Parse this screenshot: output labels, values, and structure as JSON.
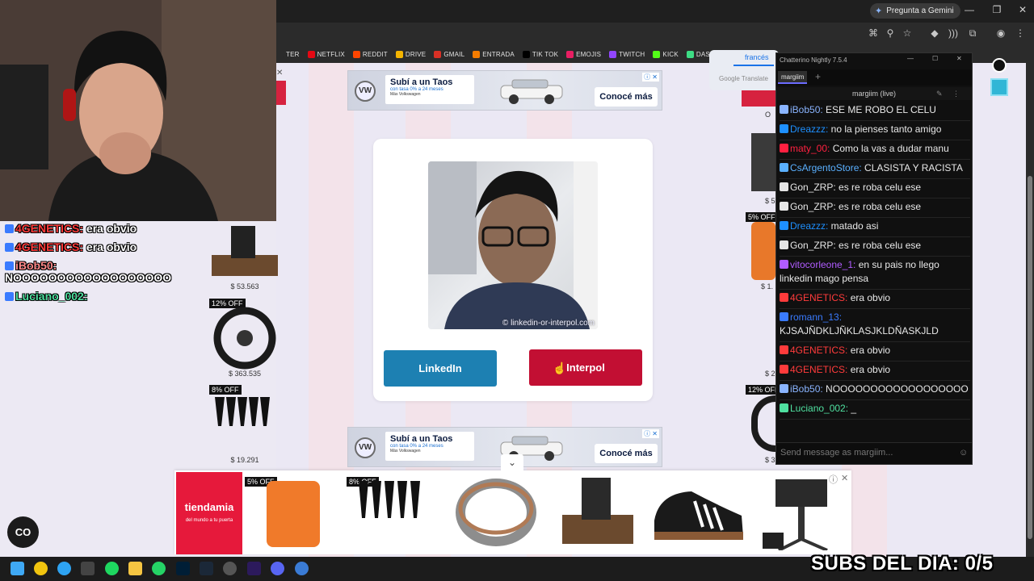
{
  "browser": {
    "gemini_label": "Pregunta a Gemini",
    "bookmarks": [
      {
        "label": "TER",
        "color": "#2b2b2b"
      },
      {
        "label": "NETFLIX",
        "color": "#e50914"
      },
      {
        "label": "REDDIT",
        "color": "#ff4500"
      },
      {
        "label": "DRIVE",
        "color": "#f4b400"
      },
      {
        "label": "GMAIL",
        "color": "#d93025"
      },
      {
        "label": "ENTRADA",
        "color": "#f57c00"
      },
      {
        "label": "TIK TOK",
        "color": "#000000"
      },
      {
        "label": "EMOJIS",
        "color": "#e91e63"
      },
      {
        "label": "TWITCH",
        "color": "#9146ff"
      },
      {
        "label": "KICK",
        "color": "#53fc18"
      },
      {
        "label": "DASHBO",
        "color": "#3ddc84"
      }
    ]
  },
  "translate": {
    "language": "francés",
    "brand": "Google Translate"
  },
  "ad": {
    "headline": "Subí a un Taos",
    "sub": "con tasa 0% a 24 meses",
    "brand_line": "Más Volkswagen",
    "cta": "Conocé más",
    "vw_mark": "VW"
  },
  "card": {
    "watermark": "© linkedin-or-interpol.com",
    "linkedin_label": "LinkedIn",
    "interpol_label": "Interpol"
  },
  "side_products": [
    {
      "price": "$ 53.563",
      "tag": ""
    },
    {
      "price": "$ 363.535",
      "tag": "12% OFF"
    },
    {
      "price": "$ 19.291",
      "tag": "8% OFF"
    }
  ],
  "right_products": [
    {
      "tag": "5% OFF",
      "price": "$ 1."
    },
    {
      "tag": "12% OFF",
      "price": "$ 3"
    },
    {
      "tag": "",
      "price": "$ 5"
    },
    {
      "tag": "",
      "price": "$ 2"
    }
  ],
  "bottom_ad": {
    "brand": "tiendamia",
    "tagline": "del mundo a tu puerta",
    "tags": [
      "5% OFF",
      "8% OFF"
    ]
  },
  "chatterino": {
    "title": "Chatterino Nightly 7.5.4",
    "tab": "margiim",
    "channel": "margiim (live)",
    "input_placeholder": "Send message as margiim...",
    "messages": [
      {
        "user": "iBob50:",
        "color": "#8ab4ff",
        "text": " ESE ME ROBO EL CELU"
      },
      {
        "user": "Dreazzz:",
        "color": "#1e90ff",
        "text": " no la pienses tanto amigo"
      },
      {
        "user": "maty_00:",
        "color": "#ff2040",
        "text": " Como la vas a dudar manu"
      },
      {
        "user": "CsArgentoStore:",
        "color": "#5ab0ff",
        "text": " CLASISTA Y RACISTA"
      },
      {
        "user": "Gon_ZRP:",
        "color": "#e6e6e6",
        "text": " es re roba celu ese"
      },
      {
        "user": "Gon_ZRP:",
        "color": "#e6e6e6",
        "text": " es re roba celu ese"
      },
      {
        "user": "Dreazzz:",
        "color": "#1e90ff",
        "text": " matado asi"
      },
      {
        "user": "Gon_ZRP:",
        "color": "#e6e6e6",
        "text": " es re roba celu ese"
      },
      {
        "user": "vitocorleone_1:",
        "color": "#b05cff",
        "text": " en su pais no llego linkedin mago pensa"
      },
      {
        "user": "4GENETICS:",
        "color": "#ff3b3b",
        "text": " era obvio"
      },
      {
        "user": "romann_13:",
        "color": "#3a7bff",
        "text": " KJSAJÑDKLJÑKLASJKLDÑASKJLD"
      },
      {
        "user": "4GENETICS:",
        "color": "#ff3b3b",
        "text": " era obvio"
      },
      {
        "user": "4GENETICS:",
        "color": "#ff3b3b",
        "text": " era obvio"
      },
      {
        "user": "iBob50:",
        "color": "#8ab4ff",
        "text": " NOOOOOOOOOOOOOOOOOO"
      },
      {
        "user": "Luciano_002:",
        "color": "#4fe0a0",
        "text": " _"
      }
    ]
  },
  "overlay_chat": [
    {
      "user": "4GENETICS:",
      "color": "#ff3b3b",
      "text": "era obvio"
    },
    {
      "user": "4GENETICS:",
      "color": "#ff3b3b",
      "text": "era obvio"
    },
    {
      "user": "iBob50:",
      "color": "#ff8a8a",
      "text": "NOOOOOOOOOOOOOOOOOO"
    },
    {
      "user": "Luciano_002:",
      "color": "#4fe0a0",
      "text": ""
    }
  ],
  "stream": {
    "subs_counter": "SUBS DEL DIA: 0/5"
  },
  "copilot_label": "CO"
}
